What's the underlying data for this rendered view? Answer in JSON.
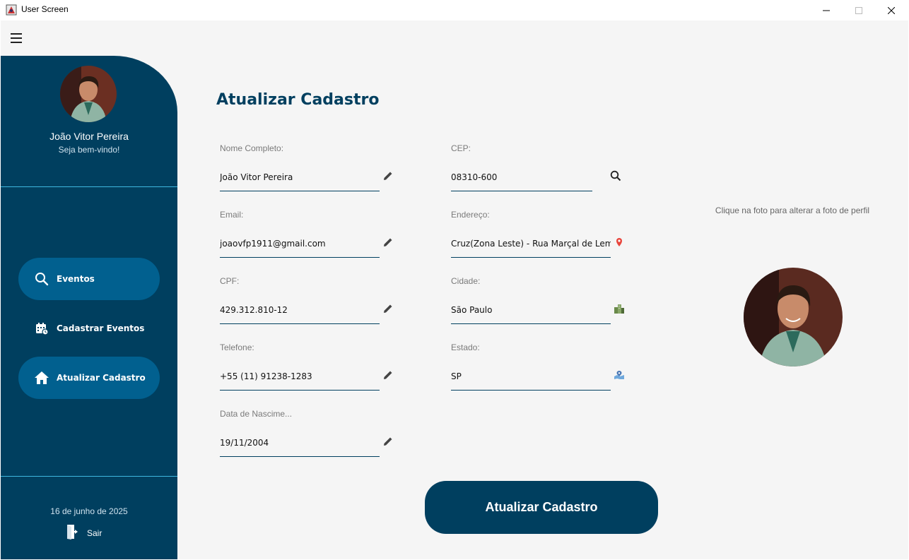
{
  "window": {
    "title": "User Screen"
  },
  "sidebar": {
    "user_name": "João Vitor Pereira",
    "welcome": "Seja bem-vindo!",
    "nav": [
      {
        "label": "Eventos",
        "icon": "search-icon"
      },
      {
        "label": "Cadastrar Eventos",
        "icon": "calendar-icon"
      },
      {
        "label": "Atualizar Cadastro",
        "icon": "home-icon"
      }
    ],
    "date": "16 de junho de 2025",
    "logout_label": "Sair"
  },
  "form": {
    "title": "Atualizar Cadastro",
    "fields": {
      "nome": {
        "label": "Nome Completo:",
        "value": "João Vitor Pereira",
        "icon": "pencil-icon"
      },
      "email": {
        "label": "Email:",
        "value": "joaovfp1911@gmail.com",
        "icon": "pencil-icon"
      },
      "cpf": {
        "label": "CPF:",
        "value": "429.312.810-12",
        "icon": "pencil-icon"
      },
      "telefone": {
        "label": "Telefone:",
        "value": "+55 (11) 91238-1283",
        "icon": "pencil-icon"
      },
      "nascimento": {
        "label": "Data de Nascime...",
        "value": "19/11/2004",
        "icon": "pencil-icon"
      },
      "cep": {
        "label": "CEP:",
        "value": "08310-600",
        "icon": "search-icon"
      },
      "endereco": {
        "label": "Endereço:",
        "value": "Cruz(Zona Leste) - Rua Marçal de Lemos",
        "icon": "map-pin-icon"
      },
      "cidade": {
        "label": "Cidade:",
        "value": "São Paulo",
        "icon": "city-icon"
      },
      "estado": {
        "label": "Estado:",
        "value": "SP",
        "icon": "map-icon"
      }
    },
    "submit_label": "Atualizar Cadastro"
  },
  "photo": {
    "hint": "Clique na foto para alterar a foto de perfil"
  },
  "colors": {
    "sidebar": "#003f5f",
    "pill": "#01608f",
    "accent_line": "#3fb8e0",
    "background": "#f5f5f5"
  }
}
